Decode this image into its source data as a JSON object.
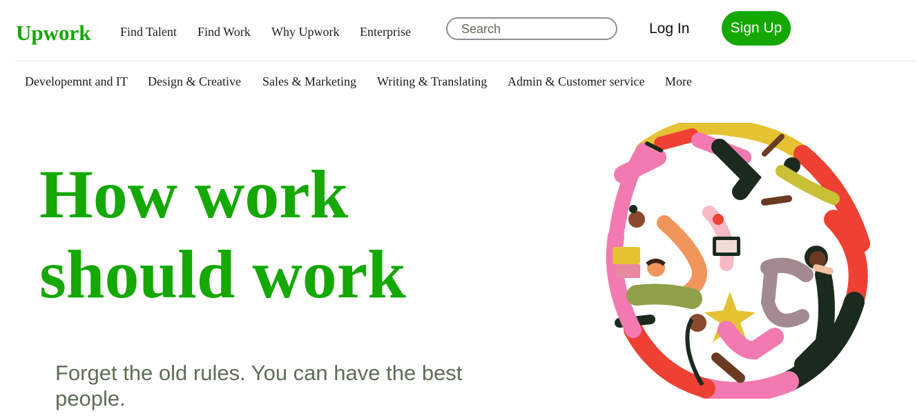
{
  "header": {
    "logo": "Upwork",
    "nav": [
      "Find Talent",
      "Find Work",
      "Why Upwork",
      "Enterprise"
    ],
    "search_placeholder": "Search",
    "login_label": "Log In",
    "signup_label": "Sign Up"
  },
  "categories": [
    "Developemnt and IT",
    "Design & Creative",
    "Sales & Marketing",
    "Writing & Translating",
    "Admin & Customer service",
    "More"
  ],
  "hero": {
    "title": "How work should work",
    "subtitle": "Forget the old rules. You can have the best people."
  },
  "colors": {
    "brand": "#14a800",
    "subtitle": "#5e6d55",
    "text": "#1a1a1a"
  }
}
